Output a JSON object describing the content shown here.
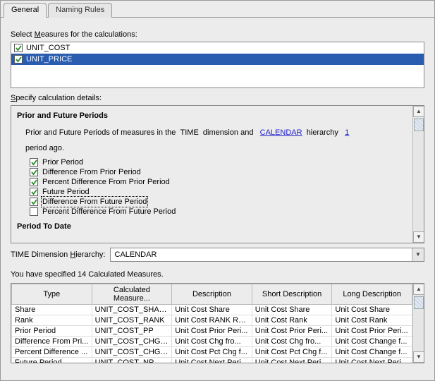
{
  "tabs": {
    "general": "General",
    "naming": "Naming Rules"
  },
  "labels": {
    "select_measures": "Select Measures for the calculations:",
    "specify_details": "Specify calculation details:",
    "time_dim_hierarchy": "TIME Dimension Hierarchy:"
  },
  "measures": {
    "items": [
      {
        "label": "UNIT_COST",
        "checked": true,
        "selected": false
      },
      {
        "label": "UNIT_PRICE",
        "checked": true,
        "selected": true
      }
    ]
  },
  "details": {
    "section_title": "Prior and Future Periods",
    "para_prefix": "Prior and Future Periods of measures in the ",
    "dimension": "TIME",
    "para_mid": " dimension and ",
    "hierarchy_link": "CALENDAR",
    "para_after_link": " hierarchy ",
    "count_link": "1",
    "para_line2": "period ago.",
    "checkboxes": [
      {
        "label": "Prior Period",
        "checked": true
      },
      {
        "label": "Difference From Prior Period",
        "checked": true
      },
      {
        "label": "Percent Difference From Prior Period",
        "checked": true
      },
      {
        "label": "Future Period",
        "checked": true
      },
      {
        "label": "Difference From Future Period",
        "checked": true,
        "focused": true
      },
      {
        "label": "Percent Difference From Future Period",
        "checked": false
      }
    ],
    "next_section_cut": "Period To Date"
  },
  "hierarchy_select": {
    "value": "CALENDAR"
  },
  "summary": "You have specified 14 Calculated Measures.",
  "table": {
    "headers": [
      "Type",
      "Calculated Measure...",
      "Description",
      "Short Description",
      "Long Description"
    ],
    "rows": [
      [
        "Share",
        "UNIT_COST_SHARE",
        "Unit Cost Share",
        "Unit Cost Share",
        "Unit Cost Share"
      ],
      [
        "Rank",
        "UNIT_COST_RANK",
        "Unit Cost RANK Rank",
        "Unit Cost Rank",
        "Unit Cost Rank"
      ],
      [
        "Prior Period",
        "UNIT_COST_PP",
        "Unit Cost Prior Peri...",
        "Unit Cost Prior Peri...",
        "Unit Cost Prior Peri..."
      ],
      [
        "Difference From Pri...",
        "UNIT_COST_CHG_PP",
        "Unit Cost Chg fro...",
        "Unit Cost Chg fro...",
        "Unit Cost Change f..."
      ],
      [
        "Percent Difference ...",
        "UNIT_COST_CHG_P...",
        "Unit Cost Pct Chg f...",
        "Unit Cost Pct Chg f...",
        "Unit Cost Change f..."
      ],
      [
        "Future Period",
        "UNIT_COST_NP",
        "Unit Cost Next Peri...",
        "Unit Cost Next Peri...",
        "Unit Cost Next Peri..."
      ]
    ]
  }
}
